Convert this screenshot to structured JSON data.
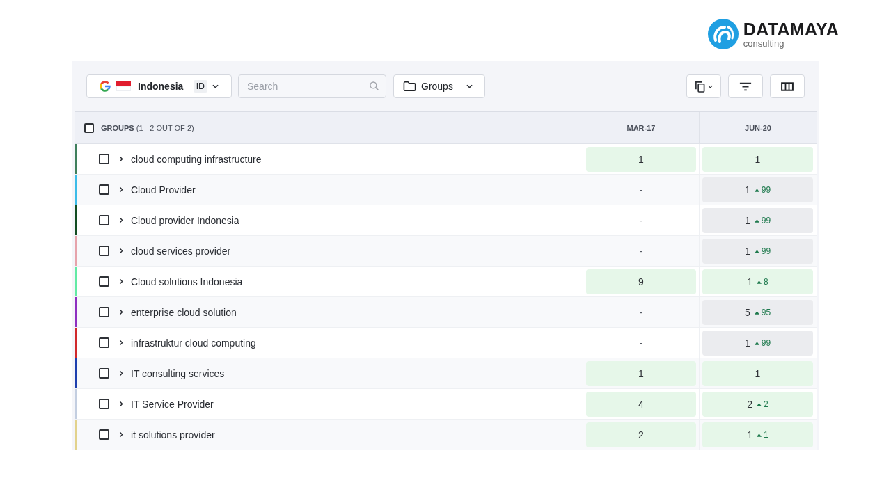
{
  "logo": {
    "name": "DATAMAYA",
    "tagline": "consulting"
  },
  "toolbar": {
    "location": {
      "country": "Indonesia",
      "code": "ID"
    },
    "search": {
      "placeholder": "Search"
    },
    "group_filter": {
      "label": "Groups"
    }
  },
  "table": {
    "select_all": {
      "checked": false
    },
    "groups_header": "**GROUPS** (1 - 2 OUT OF 2)",
    "columns": [
      "MAR-17",
      "JUN-20"
    ],
    "rows": [
      {
        "name": "cloud computing infrastructure",
        "color": "#3f7f5c",
        "checked": false,
        "expanded": false,
        "cells": [
          {
            "kind": "positive",
            "value": "1"
          },
          {
            "kind": "positive",
            "value": "1"
          }
        ]
      },
      {
        "name": "Cloud Provider",
        "color": "#3cbce8",
        "checked": false,
        "expanded": false,
        "cells": [
          {
            "kind": "empty",
            "value": "-"
          },
          {
            "kind": "neutral",
            "value": "1",
            "change": {
              "kind": "increase",
              "value": "99"
            }
          }
        ]
      },
      {
        "name": "Cloud provider Indonesia",
        "color": "#124d22",
        "checked": false,
        "expanded": false,
        "cells": [
          {
            "kind": "empty",
            "value": "-"
          },
          {
            "kind": "neutral",
            "value": "1",
            "change": {
              "kind": "increase",
              "value": "99"
            }
          }
        ]
      },
      {
        "name": "cloud services provider",
        "color": "#e6a3ab",
        "checked": false,
        "expanded": false,
        "cells": [
          {
            "kind": "empty",
            "value": "-"
          },
          {
            "kind": "neutral",
            "value": "1",
            "change": {
              "kind": "increase",
              "value": "99"
            }
          }
        ]
      },
      {
        "name": "Cloud solutions Indonesia",
        "color": "#62eaa4",
        "checked": false,
        "expanded": false,
        "cells": [
          {
            "kind": "positive",
            "value": "9"
          },
          {
            "kind": "positive",
            "value": "1",
            "change": {
              "kind": "increase",
              "value": "8"
            }
          }
        ]
      },
      {
        "name": "enterprise cloud solution",
        "color": "#8e2fc0",
        "checked": false,
        "expanded": false,
        "cells": [
          {
            "kind": "empty",
            "value": "-"
          },
          {
            "kind": "neutral",
            "value": "5",
            "change": {
              "kind": "increase",
              "value": "95"
            }
          }
        ]
      },
      {
        "name": "infrastruktur cloud computing",
        "color": "#d0282b",
        "checked": false,
        "expanded": false,
        "cells": [
          {
            "kind": "empty",
            "value": "-"
          },
          {
            "kind": "neutral",
            "value": "1",
            "change": {
              "kind": "increase",
              "value": "99"
            }
          }
        ]
      },
      {
        "name": "IT consulting services",
        "color": "#1d3fae",
        "checked": false,
        "expanded": false,
        "cells": [
          {
            "kind": "positive",
            "value": "1"
          },
          {
            "kind": "positive",
            "value": "1"
          }
        ]
      },
      {
        "name": "IT Service Provider",
        "color": "#c3cee0",
        "checked": false,
        "expanded": false,
        "cells": [
          {
            "kind": "positive",
            "value": "4"
          },
          {
            "kind": "positive",
            "value": "2",
            "change": {
              "kind": "increase",
              "value": "2"
            }
          }
        ]
      },
      {
        "name": "it solutions provider",
        "color": "#e2d28c",
        "checked": false,
        "expanded": false,
        "cells": [
          {
            "kind": "positive",
            "value": "2"
          },
          {
            "kind": "positive",
            "value": "1",
            "change": {
              "kind": "increase",
              "value": "1"
            }
          }
        ]
      }
    ]
  }
}
